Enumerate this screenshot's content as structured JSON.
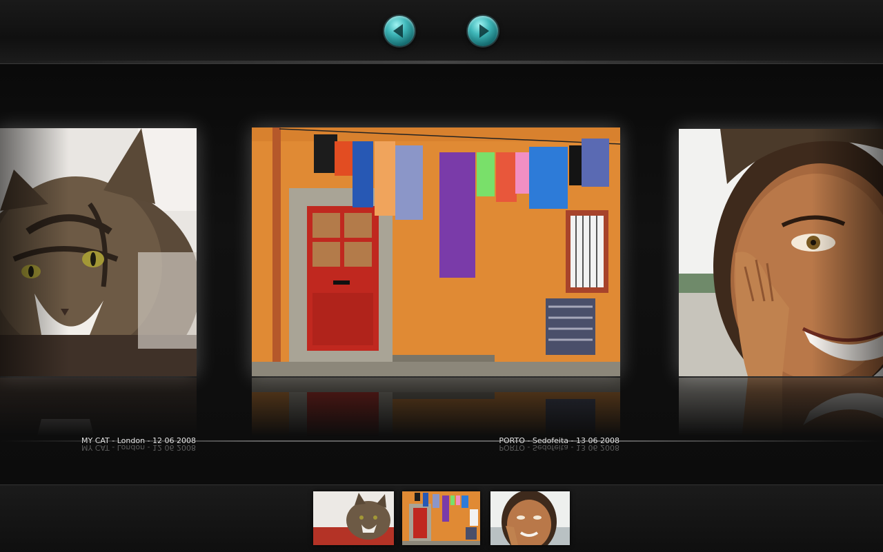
{
  "navigation": {
    "prev_icon": "arrow-left-icon",
    "next_icon": "arrow-right-icon",
    "accent_color": "#3fb7b9"
  },
  "gallery": {
    "photos": [
      {
        "id": "cat",
        "caption": "MY CAT - London - 12 06 2008",
        "position": "left"
      },
      {
        "id": "porto",
        "caption": "PORTO - Sedofeita - 13 06 2008",
        "position": "center"
      },
      {
        "id": "girl",
        "caption": "",
        "position": "right"
      }
    ]
  },
  "thumbnails": {
    "count": 3,
    "items": [
      "cat",
      "porto",
      "girl"
    ]
  }
}
